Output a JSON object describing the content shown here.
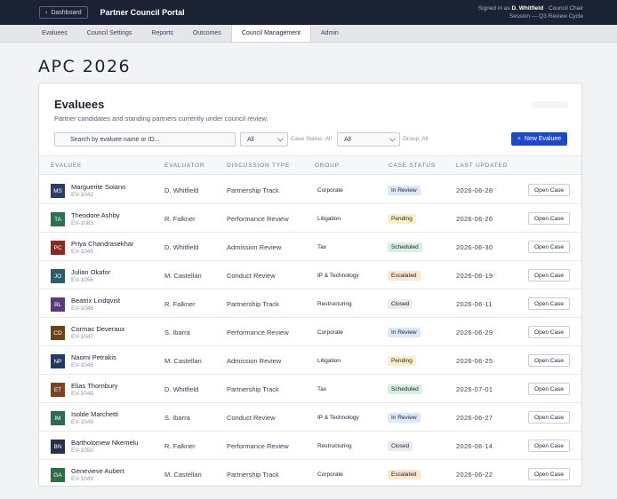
{
  "topbar": {
    "dashboard_label": "Dashboard",
    "portal_title": "Partner Council Portal",
    "signed_prefix": "Signed in as ",
    "user_name": "D. Whitfield",
    "user_role": " · Council Chair",
    "session": "Session — Q3 Review Cycle"
  },
  "tabs": [
    {
      "label": "Evaluees",
      "active": false
    },
    {
      "label": "Council Settings",
      "active": false
    },
    {
      "label": "Reports",
      "active": false
    },
    {
      "label": "Outcomes",
      "active": false
    },
    {
      "label": "Council Management",
      "active": true
    },
    {
      "label": "Admin",
      "active": false
    }
  ],
  "page_heading": "APC 2026",
  "card": {
    "title": "Evaluees",
    "subtitle": "Partner candidates and standing partners currently under council review."
  },
  "filters": {
    "search_placeholder": "Search by evaluee name or ID...",
    "filter1_value": "All",
    "filter1_label": "Case Status: All",
    "filter2_value": "All",
    "filter2_label": "Group: All",
    "new_button": "New Evaluee"
  },
  "columns": [
    "EVALUEE",
    "EVALUATOR",
    "DISCUSSION TYPE",
    "GROUP",
    "CASE STATUS",
    "LAST UPDATED"
  ],
  "status_colors": {
    "In Review": "#dbe8f7",
    "Pending": "#fbefc9",
    "Scheduled": "#d6f0e0",
    "Escalated": "#fbe6cf",
    "Closed": "#e9ebef"
  },
  "action_label": "Open Case",
  "rows": [
    {
      "initials": "MS",
      "color": "#2b3f63",
      "name": "Marguerite Solano",
      "id": "EV-1042",
      "evaluator": "D. Whitfield",
      "type": "Partnership Track",
      "group": "Corporate",
      "status": "In Review",
      "updated": "2026-06-28"
    },
    {
      "initials": "TA",
      "color": "#2f6f52",
      "name": "Theodore Ashby",
      "id": "EV-1083",
      "evaluator": "R. Falkner",
      "type": "Performance Review",
      "group": "Litigation",
      "status": "Pending",
      "updated": "2026-06-26"
    },
    {
      "initials": "PC",
      "color": "#8a2a26",
      "name": "Priya Chandrasekhar",
      "id": "EV-1045",
      "evaluator": "D. Whitfield",
      "type": "Admission Review",
      "group": "Tax",
      "status": "Scheduled",
      "updated": "2026-06-30"
    },
    {
      "initials": "JO",
      "color": "#2d5d6b",
      "name": "Julian Okafor",
      "id": "EV-1056",
      "evaluator": "M. Castellan",
      "type": "Conduct Review",
      "group": "IP & Technology",
      "status": "Escalated",
      "updated": "2026-06-19"
    },
    {
      "initials": "BL",
      "color": "#5b3a7a",
      "name": "Beatrix Lindqvist",
      "id": "EV-1048",
      "evaluator": "R. Falkner",
      "type": "Partnership Track",
      "group": "Restructuring",
      "status": "Closed",
      "updated": "2026-06-11"
    },
    {
      "initials": "CD",
      "color": "#6a4318",
      "name": "Cormac Deveraux",
      "id": "EV-1047",
      "evaluator": "S. Ibarra",
      "type": "Performance Review",
      "group": "Corporate",
      "status": "In Review",
      "updated": "2026-06-29"
    },
    {
      "initials": "NP",
      "color": "#243a63",
      "name": "Naomi Petrakis",
      "id": "EV-1048",
      "evaluator": "M. Castellan",
      "type": "Admission Review",
      "group": "Litigation",
      "status": "Pending",
      "updated": "2026-06-25"
    },
    {
      "initials": "ET",
      "color": "#7a4420",
      "name": "Elias Thornbury",
      "id": "EV-1049",
      "evaluator": "D. Whitfield",
      "type": "Partnership Track",
      "group": "Tax",
      "status": "Scheduled",
      "updated": "2026-07-01"
    },
    {
      "initials": "IM",
      "color": "#2d6a5a",
      "name": "Isolde Marchetti",
      "id": "EV-1049",
      "evaluator": "S. Ibarra",
      "type": "Conduct Review",
      "group": "IP & Technology",
      "status": "In Review",
      "updated": "2026-06-27"
    },
    {
      "initials": "BN",
      "color": "#26324a",
      "name": "Bartholomew Nkemelu",
      "id": "EV-1050",
      "evaluator": "R. Falkner",
      "type": "Performance Review",
      "group": "Restructuring",
      "status": "Closed",
      "updated": "2026-06-14"
    },
    {
      "initials": "GA",
      "color": "#2f6e44",
      "name": "Genevieve Aubert",
      "id": "EV-1049",
      "evaluator": "M. Castellan",
      "type": "Partnership Track",
      "group": "Corporate",
      "status": "Escalated",
      "updated": "2026-06-22"
    }
  ]
}
